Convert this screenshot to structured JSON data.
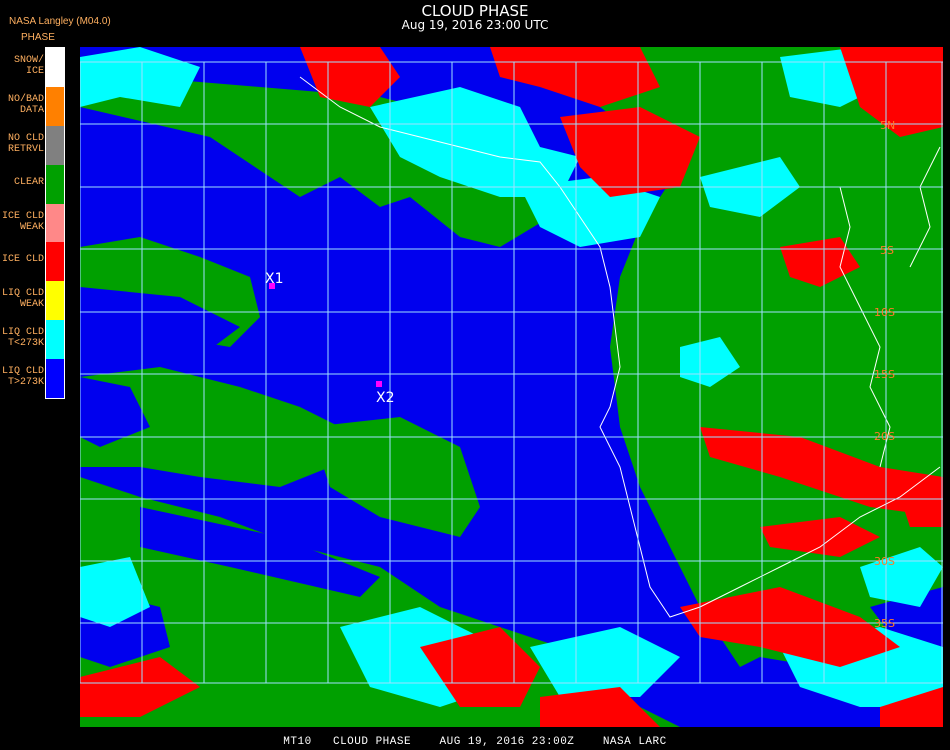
{
  "header": {
    "title": "CLOUD PHASE",
    "timestamp": "Aug 19, 2016 23:00 UTC",
    "source": "NASA Langley (M04.0)"
  },
  "legend": {
    "heading": "PHASE",
    "items": [
      {
        "label": "SNOW/\nICE",
        "color": "#ffffff"
      },
      {
        "label": "NO/BAD\nDATA",
        "color": "#ff8000"
      },
      {
        "label": "NO CLD\nRETRVL",
        "color": "#808080"
      },
      {
        "label": "CLEAR",
        "color": "#00a000"
      },
      {
        "label": "ICE CLD\nWEAK",
        "color": "#ff8888"
      },
      {
        "label": "ICE CLD",
        "color": "#ff0000"
      },
      {
        "label": "LIQ CLD\nWEAK",
        "color": "#ffff00"
      },
      {
        "label": "LIQ CLD\nT<273K",
        "color": "#00ffff"
      },
      {
        "label": "LIQ CLD\nT>273K",
        "color": "#0000ff"
      }
    ]
  },
  "map": {
    "lat_labels": [
      "5N",
      "5S",
      "10S",
      "15S",
      "20S",
      "30S",
      "35S"
    ],
    "markers": [
      {
        "label": "X1"
      },
      {
        "label": "X2"
      }
    ]
  },
  "footer": {
    "text": "MT10   CLOUD PHASE    AUG 19, 2016 23:00Z    NASA LARC"
  }
}
